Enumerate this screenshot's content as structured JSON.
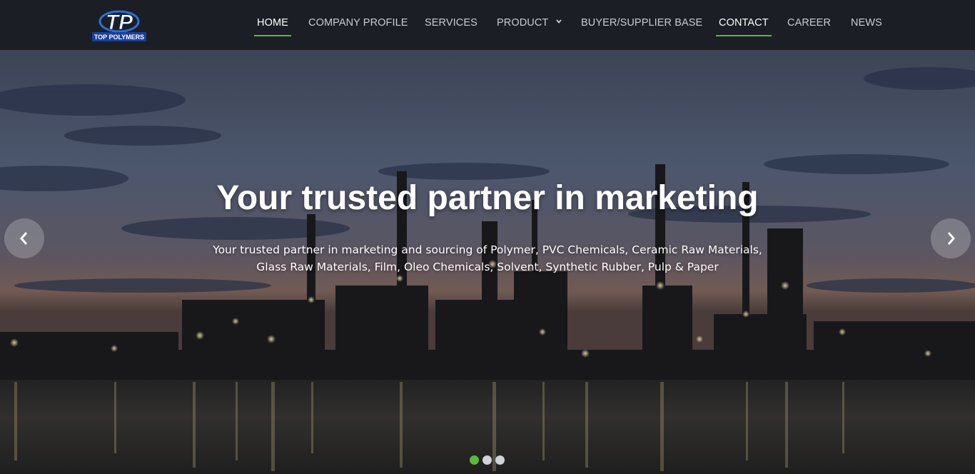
{
  "brand": {
    "logo_letters": "TP",
    "logo_text": "TOP POLYMERS"
  },
  "nav": {
    "items": [
      {
        "label": "HOME",
        "active": true
      },
      {
        "label": "COMPANY PROFILE",
        "active": false
      },
      {
        "label": "SERVICES",
        "active": false
      },
      {
        "label": "PRODUCT",
        "active": false,
        "has_dropdown": true
      },
      {
        "label": "BUYER/SUPPLIER BASE",
        "active": false
      },
      {
        "label": "CONTACT",
        "active": true
      },
      {
        "label": "CAREER",
        "active": false
      },
      {
        "label": "NEWS",
        "active": false
      }
    ]
  },
  "hero": {
    "title": "Your trusted partner in marketing",
    "subtitle": "Your trusted partner in marketing and sourcing of Polymer, PVC Chemicals, Ceramic Raw Materials, Glass Raw Materials, Film, Oleo Chemicals, Solvent, Synthetic Rubber, Pulp & Paper",
    "background_description_icon": "refinery-at-dusk-image",
    "prev_icon": "chevron-left-icon",
    "next_icon": "chevron-right-icon",
    "slides_total": 3,
    "active_slide": 1
  },
  "colors": {
    "header_bg": "#1b1e24",
    "accent_green": "#5cb83c",
    "nav_text": "#c9ccd1",
    "nav_active_text": "#ffffff"
  }
}
